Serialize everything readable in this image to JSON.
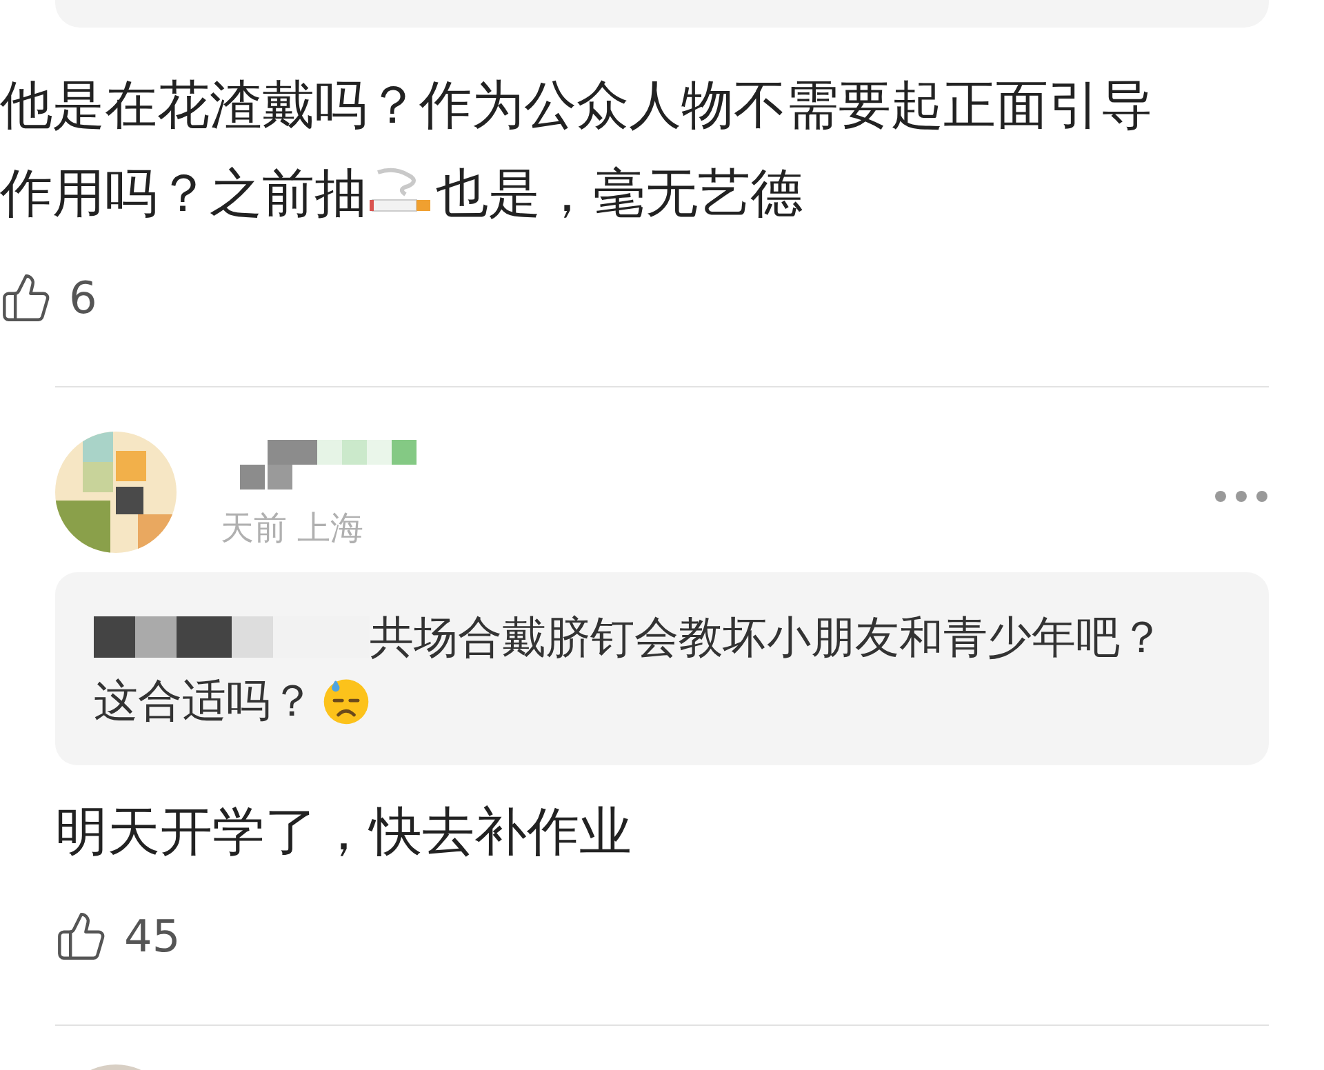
{
  "comments": [
    {
      "body": [
        {
          "kind": "text",
          "text": "他是在花渣戴吗？作为公众人物不需要起正面引导作用吗？之前抽"
        },
        {
          "kind": "cigarette"
        },
        {
          "kind": "text",
          "text": "也是，毫无艺德"
        }
      ],
      "likes": "6"
    },
    {
      "header": {
        "meta": "天前 上海"
      },
      "quote": [
        {
          "kind": "text",
          "text": "共场合戴脐钉会教坏小朋友和青少年吧？这合适吗？"
        },
        {
          "kind": "sweat-face"
        }
      ],
      "body": [
        {
          "kind": "text",
          "text": "明天开学了，快去补作业"
        }
      ],
      "likes": "45"
    }
  ]
}
